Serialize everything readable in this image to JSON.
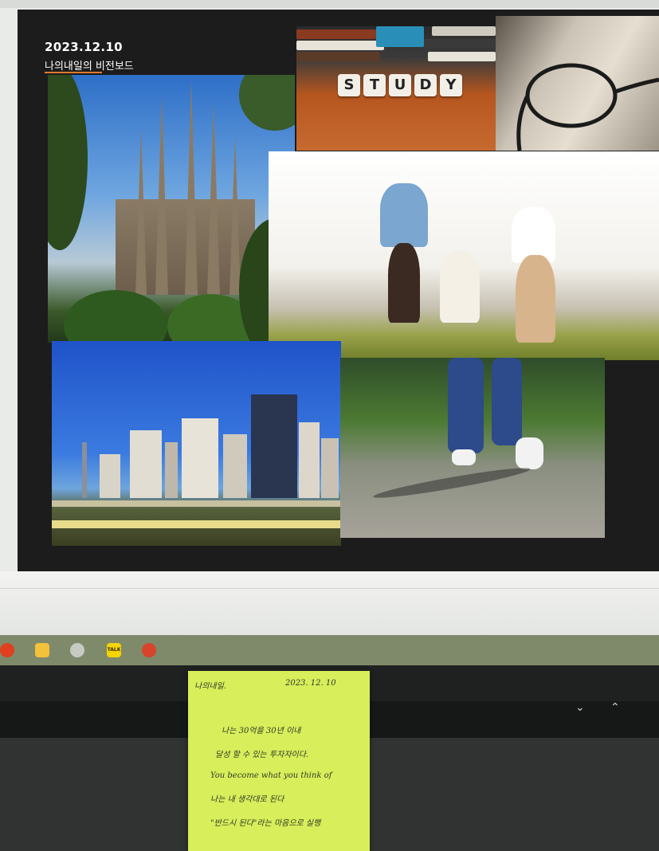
{
  "slide": {
    "date": "2023.12.10",
    "title": "나의내일의 비전보드"
  },
  "photos": {
    "study_tiles": [
      "S",
      "T",
      "U",
      "D",
      "Y"
    ]
  },
  "taskbar": {
    "icons": [
      "app-icon",
      "file-explorer-icon",
      "browser-icon",
      "kakaotalk-icon",
      "powerpoint-icon"
    ],
    "kakaotalk_label": "TALK",
    "tray_icons": [
      "chevron-down-icon",
      "chevron-up-icon"
    ]
  },
  "sticky_note": {
    "header_left": "나의내일.",
    "header_right": "2023. 12. 10",
    "lines": [
      "나는 30억을 30년 이내",
      "달성 할 수 있는 투자자이다.",
      "You become what you think of",
      "나는 내 생각대로 된다",
      "\"반드시 된다\"라는 마음으로 실행"
    ]
  },
  "colors": {
    "slide_background": "#1c1c1c",
    "title_underline": "#e07a2f",
    "sticky_note": "#d8ee5a",
    "taskbar": "#7f8a6a"
  }
}
